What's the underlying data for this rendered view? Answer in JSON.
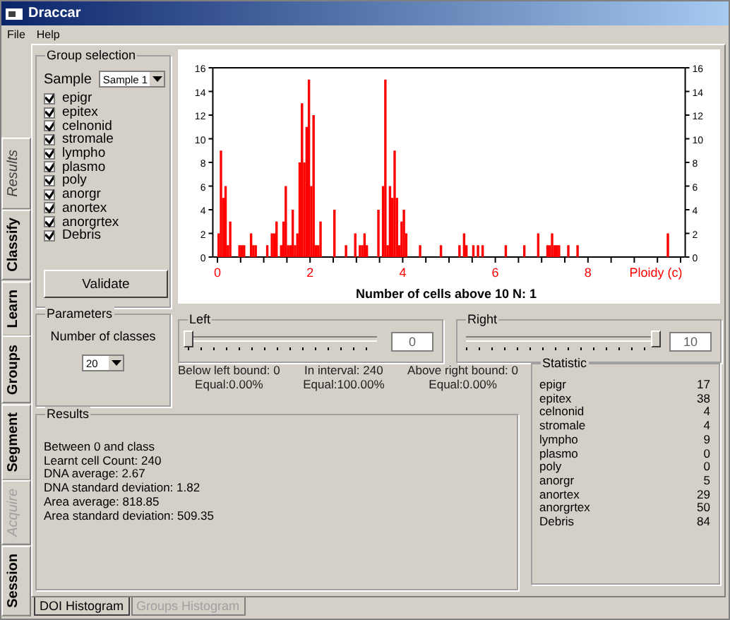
{
  "window": {
    "title": "Draccar"
  },
  "menu": [
    "File",
    "Help"
  ],
  "side_tabs": [
    {
      "label": "Results",
      "selected": true,
      "disabled": false
    },
    {
      "label": "Classify",
      "selected": false,
      "disabled": false
    },
    {
      "label": "Learn",
      "selected": false,
      "disabled": false
    },
    {
      "label": "Groups",
      "selected": false,
      "disabled": false
    },
    {
      "label": "Segment",
      "selected": false,
      "disabled": false
    },
    {
      "label": "Acquire",
      "selected": false,
      "disabled": true
    },
    {
      "label": "Session",
      "selected": false,
      "disabled": false
    }
  ],
  "group_selection": {
    "title": "Group selection",
    "sample_label": "Sample",
    "sample_value": "Sample 1",
    "groups": [
      {
        "label": "epigr",
        "checked": true
      },
      {
        "label": "epitex",
        "checked": true
      },
      {
        "label": "celnonid",
        "checked": true
      },
      {
        "label": "stromale",
        "checked": true
      },
      {
        "label": "lympho",
        "checked": true
      },
      {
        "label": "plasmo",
        "checked": true
      },
      {
        "label": "poly",
        "checked": true
      },
      {
        "label": "anorgr",
        "checked": true
      },
      {
        "label": "anortex",
        "checked": true
      },
      {
        "label": "anorgrtex",
        "checked": true
      },
      {
        "label": "Debris",
        "checked": true
      }
    ],
    "button": "Validate"
  },
  "histogram": {
    "chart_data": {
      "type": "bar",
      "title": "Number of cells above 10 N: 1",
      "xlabel": "Ploidy (c)",
      "xlim": [
        -0.1,
        10.1
      ],
      "ylim": [
        0,
        16
      ],
      "xticks": [
        0,
        2,
        4,
        6,
        8
      ],
      "yticks": [
        0,
        2,
        4,
        6,
        8,
        10,
        12,
        14,
        16
      ],
      "x": [
        0,
        0.05,
        0.1,
        0.15,
        0.2,
        0.25,
        0.45,
        0.5,
        0.55,
        0.7,
        0.75,
        0.8,
        1.05,
        1.15,
        1.2,
        1.25,
        1.35,
        1.4,
        1.45,
        1.5,
        1.55,
        1.6,
        1.65,
        1.7,
        1.75,
        1.8,
        1.85,
        1.9,
        1.95,
        2,
        2.05,
        2.1,
        2.15,
        2.2,
        2.5,
        2.75,
        2.95,
        3.05,
        3.1,
        3.15,
        3.2,
        3.45,
        3.55,
        3.6,
        3.65,
        3.7,
        3.75,
        3.8,
        3.85,
        3.9,
        3.95,
        4,
        4.05,
        4.35,
        4.8,
        5.2,
        5.3,
        5.35,
        5.5,
        5.6,
        5.7,
        6.2,
        6.6,
        6.9,
        7.1,
        7.15,
        7.2,
        7.25,
        7.3,
        7.35,
        7.55,
        7.75,
        9.7
      ],
      "series": [
        {
          "color": "#ff0000",
          "values": [
            2,
            9,
            5,
            6,
            1,
            3,
            1,
            1,
            1,
            2,
            1,
            1,
            1,
            2,
            2,
            3,
            1,
            3,
            6,
            1,
            1,
            4,
            1,
            2,
            8,
            13,
            8,
            11,
            15,
            6,
            12,
            1,
            1,
            3,
            4,
            1,
            2,
            1,
            1,
            2,
            1,
            4,
            6,
            15,
            1,
            6,
            5,
            9,
            5,
            1,
            3,
            4,
            2,
            1,
            1,
            1,
            2,
            1,
            1,
            1,
            1,
            1,
            1,
            2,
            1,
            1,
            2,
            1,
            1,
            1,
            1,
            1,
            2
          ]
        }
      ]
    },
    "right_axis_labels": [
      "16",
      "14",
      "12",
      "10",
      "8",
      "6",
      "4",
      "2",
      "0"
    ]
  },
  "parameters": {
    "title": "Parameters",
    "classes_label": "Number of classes",
    "classes_value": "20"
  },
  "left_bound": {
    "title": "Left",
    "level": 0,
    "value": "0"
  },
  "right_bound": {
    "title": "Right",
    "level": 1,
    "value": "10"
  },
  "counts": [
    {
      "label": "Below left bound: 0",
      "equal": "Equal:0.00%"
    },
    {
      "label": "In interval: 240",
      "equal": "Equal:100.00%"
    },
    {
      "label": "Above right bound: 0",
      "equal": "Equal:0.00%"
    }
  ],
  "results": {
    "title": "Results",
    "lines": [
      "Between 0 and class",
      "Learnt cell Count: 240",
      "DNA average: 2.67",
      "DNA standard deviation: 1.82",
      "Area average: 818.85",
      "Area standard deviation: 509.35"
    ]
  },
  "statistic": {
    "title": "Statistic",
    "rows": [
      {
        "name": "epigr",
        "value": "17"
      },
      {
        "name": "epitex",
        "value": "38"
      },
      {
        "name": "celnonid",
        "value": "4"
      },
      {
        "name": "stromale",
        "value": "4"
      },
      {
        "name": "lympho",
        "value": "9"
      },
      {
        "name": "plasmo",
        "value": "0"
      },
      {
        "name": "poly",
        "value": "0"
      },
      {
        "name": "anorgr",
        "value": "5"
      },
      {
        "name": "anortex",
        "value": "29"
      },
      {
        "name": "anorgrtex",
        "value": "50"
      },
      {
        "name": "Debris",
        "value": "84"
      }
    ]
  },
  "bottom_tabs": [
    {
      "label": "DOI Histogram",
      "selected": true
    },
    {
      "label": "Groups Histogram",
      "selected": false
    }
  ]
}
